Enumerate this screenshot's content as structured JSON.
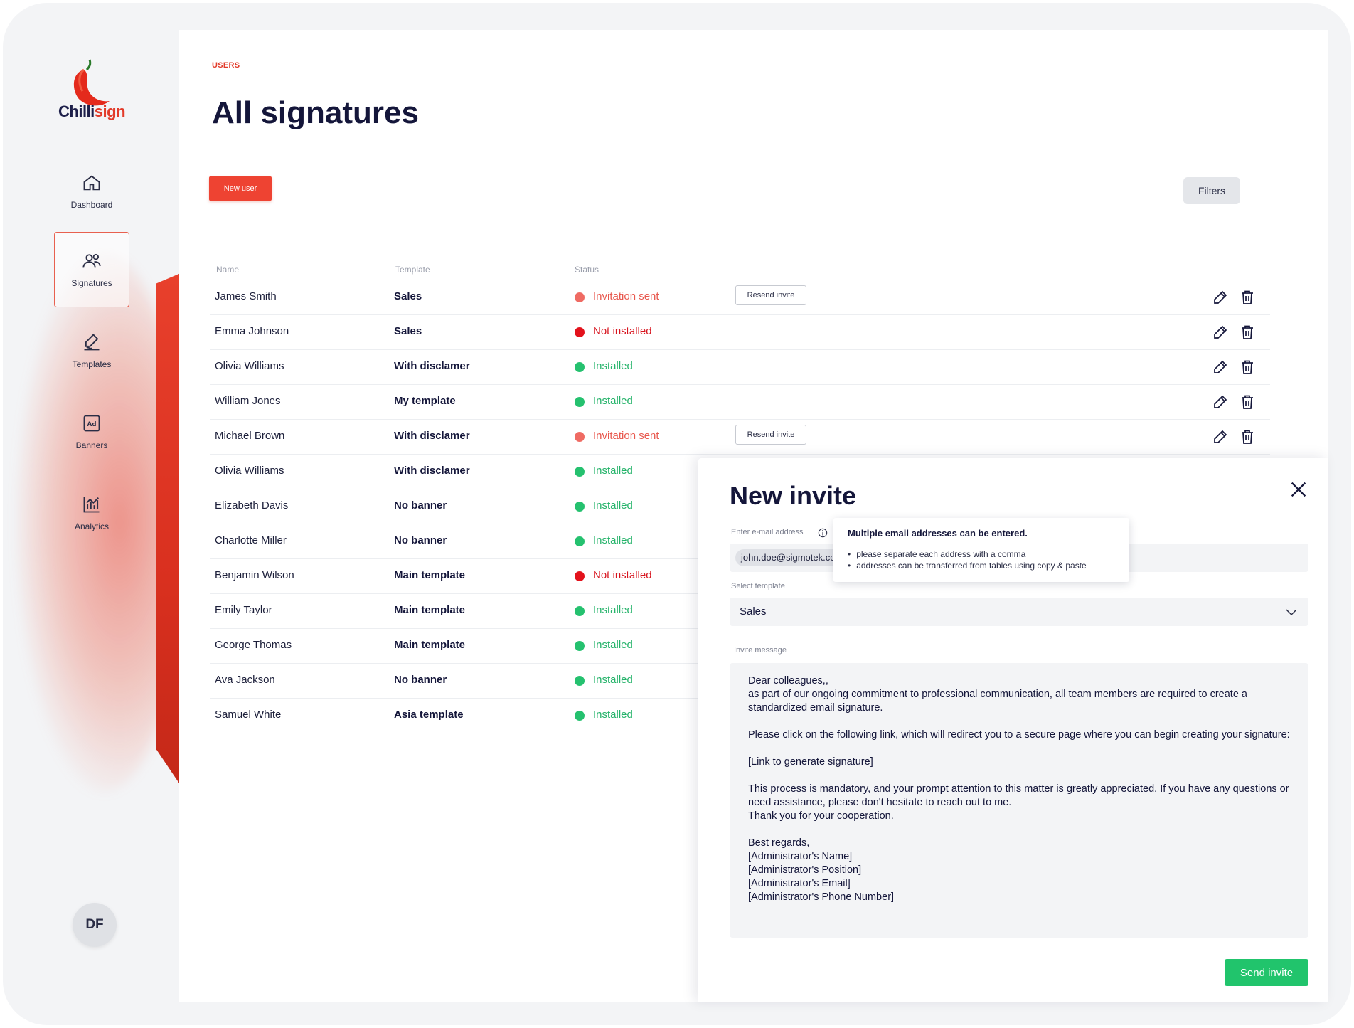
{
  "app": {
    "logo_part1": "Chilli",
    "logo_part2": "sign"
  },
  "sidebar": {
    "items": [
      {
        "label": "Dashboard",
        "icon": "home-icon"
      },
      {
        "label": "Signatures",
        "icon": "users-icon",
        "active": true
      },
      {
        "label": "Templates",
        "icon": "signature-pen-icon"
      },
      {
        "label": "Banners",
        "icon": "ad-banner-icon"
      },
      {
        "label": "Analytics",
        "icon": "bar-chart-icon"
      }
    ],
    "avatar_initials": "DF"
  },
  "main": {
    "breadcrumb": "USERS",
    "title": "All signatures",
    "new_user_label": "New user",
    "filters_label": "Filters",
    "columns": {
      "name": "Name",
      "template": "Template",
      "status": "Status"
    },
    "resend_label": "Resend invite",
    "rows": [
      {
        "name": "James Smith",
        "template": "Sales",
        "status": "Invitation sent",
        "state": "pink",
        "resend": true
      },
      {
        "name": "Emma Johnson",
        "template": "Sales",
        "status": "Not installed",
        "state": "red"
      },
      {
        "name": "Olivia Williams",
        "template": "With disclamer",
        "status": "Installed",
        "state": "green"
      },
      {
        "name": "William Jones",
        "template": "My template",
        "status": "Installed",
        "state": "green"
      },
      {
        "name": "Michael Brown",
        "template": "With disclamer",
        "status": "Invitation sent",
        "state": "pink",
        "resend": true
      },
      {
        "name": "Olivia Williams",
        "template": "With disclamer",
        "status": "Installed",
        "state": "green"
      },
      {
        "name": "Elizabeth Davis",
        "template": "No banner",
        "status": "Installed",
        "state": "green"
      },
      {
        "name": "Charlotte Miller",
        "template": "No banner",
        "status": "Installed",
        "state": "green"
      },
      {
        "name": "Benjamin Wilson",
        "template": "Main template",
        "status": "Not installed",
        "state": "red"
      },
      {
        "name": "Emily Taylor",
        "template": "Main template",
        "status": "Installed",
        "state": "green"
      },
      {
        "name": "George Thomas",
        "template": "Main template",
        "status": "Installed",
        "state": "green"
      },
      {
        "name": "Ava Jackson",
        "template": "No banner",
        "status": "Installed",
        "state": "green"
      },
      {
        "name": "Samuel White",
        "template": "Asia template",
        "status": "Installed",
        "state": "green"
      }
    ]
  },
  "modal": {
    "title": "New invite",
    "email_label": "Enter e-mail address",
    "email_chip": "john.doe@sigmotek.com",
    "tooltip": {
      "title": "Multiple email addresses can be entered.",
      "items": [
        "please separate each address with a comma",
        "addresses can be transferred from tables using copy & paste"
      ]
    },
    "template_label": "Select template",
    "template_value": "Sales",
    "message_label": "Invite message",
    "message": "Dear colleagues,,\nas part of our ongoing commitment to professional communication, all team members are required to create a standardized email signature.\n\nPlease click on the following link, which will redirect you to a secure page where you can begin creating your signature:\n\n[Link to generate signature]\n\nThis process is mandatory, and your prompt attention to this matter is greatly appreciated. If you have any questions or need assistance, please don't hesitate to reach out to me.\nThank you for your cooperation.\n\nBest regards,\n[Administrator's Name]\n[Administrator's Position]\n[Administrator's Email]\n[Administrator's Phone Number]",
    "send_label": "Send invite"
  },
  "colors": {
    "brand_red": "#ee4332",
    "installed_green": "#25b36a",
    "not_installed_red": "#d7141e",
    "invitation_pink": "#e8584e",
    "send_green": "#21c46c"
  }
}
